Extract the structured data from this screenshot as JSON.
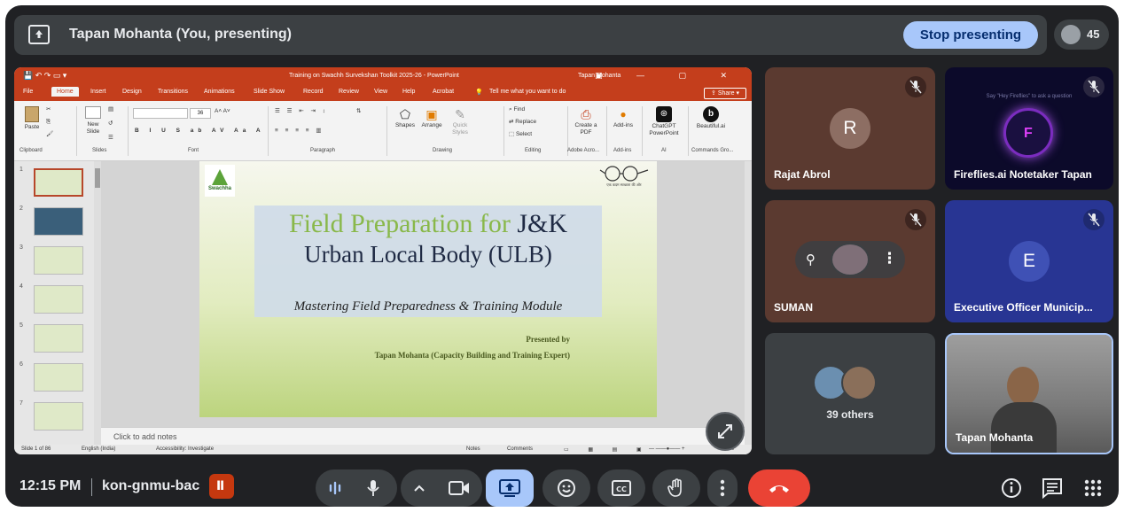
{
  "present_bar": {
    "title": "Tapan Mohanta (You, presenting)",
    "stop_label": "Stop presenting",
    "participant_count": "45"
  },
  "ppt": {
    "window_title": "Training on Swachh Survekshan Toolkit 2025-26  -  PowerPoint",
    "user": "Tapan Mohanta",
    "tabs": [
      "File",
      "Home",
      "Insert",
      "Design",
      "Transitions",
      "Animations",
      "Slide Show",
      "Record",
      "Review",
      "View",
      "Help",
      "Acrobat"
    ],
    "tell_me": "Tell me what you want to do",
    "share": "Share",
    "ribbon": {
      "paste": "Paste",
      "new_slide": "New Slide",
      "font_size": "36",
      "shapes": "Shapes",
      "arrange": "Arrange",
      "quick_styles": "Quick Styles",
      "find": "Find",
      "replace": "Replace",
      "select": "Select",
      "create_pdf": "Create a PDF",
      "add_ins": "Add-ins",
      "chatgpt": "ChatGPT PowerPoint",
      "beautiful": "Beautiful.ai",
      "groups": [
        "Clipboard",
        "Slides",
        "Font",
        "Paragraph",
        "Drawing",
        "Editing",
        "Adobe Acro...",
        "Add-ins",
        "AI",
        "Commands Gro..."
      ]
    },
    "thumb_numbers": [
      "1",
      "2",
      "3",
      "4",
      "5",
      "6",
      "7"
    ],
    "slide": {
      "title_green": "Field Preparation for ",
      "title_dark": "J&K",
      "title_line2": "Urban Local Body (ULB)",
      "subtitle": "Mastering Field Preparedness & Training Module",
      "presented_by": "Presented by",
      "presenter": "Tapan Mohanta (Capacity Building and Training Expert)",
      "logo_text": "Swachha",
      "glasses_caption": "एक कदम स्वच्छता की ओर"
    },
    "notes_placeholder": "Click to add notes",
    "status": {
      "slide_of": "Slide 1 of 86",
      "language": "English (India)",
      "accessibility": "Accessibility: Investigate",
      "notes": "Notes",
      "comments": "Comments",
      "zoom": "62%"
    }
  },
  "participants": [
    {
      "name": "Rajat Abrol",
      "initial": "R",
      "avatar_color": "#8d6e63",
      "tile_color": "#5b3a30",
      "muted": true
    },
    {
      "name": "Fireflies.ai Notetaker Tapan",
      "initial": "",
      "tile_color": "#0c0a2a",
      "muted": true,
      "overlay_text": "Say \"Hey Fireflies\" to ask a question"
    },
    {
      "name": "SUMAN",
      "tile_color": "#5b3a30",
      "muted": true
    },
    {
      "name": "Executive Officer Municip...",
      "initial": "E",
      "avatar_color": "#3f51b5",
      "tile_color": "#283593",
      "muted": true
    },
    {
      "name": "39 others",
      "tile_color": "#3c4043"
    },
    {
      "name": "Tapan Mohanta",
      "tile_color": "#6d6d6d"
    }
  ],
  "bottom_bar": {
    "time": "12:15 PM",
    "meeting_code": "kon-gnmu-bac",
    "host_badge": "Ⅱ"
  },
  "colors": {
    "bg": "#202124",
    "panel": "#3c4043",
    "accent": "#a8c7fa",
    "hangup": "#ea4335",
    "ppt_brand": "#c43e1c"
  }
}
